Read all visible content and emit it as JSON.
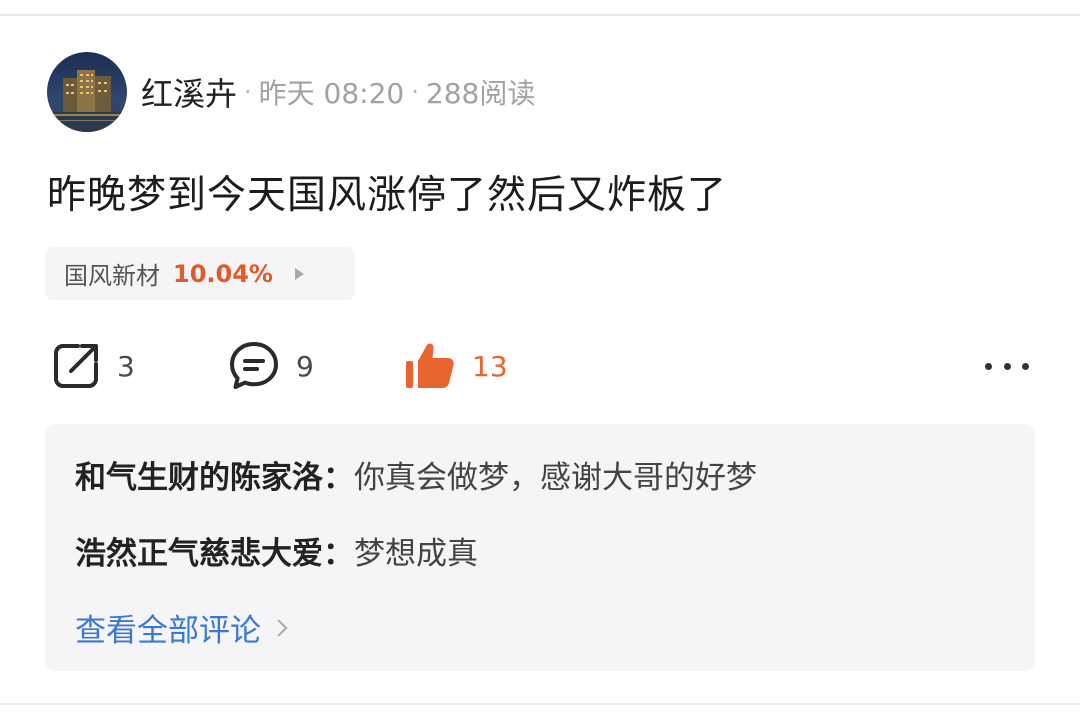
{
  "post": {
    "author": "红溪卉",
    "time": "昨天 08:20",
    "reads": "288阅读",
    "separator": "·",
    "text": "昨晚梦到今天国风涨停了然后又炸板了"
  },
  "stock": {
    "name": "国风新材",
    "change": "10.04%",
    "change_color": "#e05a2b"
  },
  "actions": {
    "share_count": "3",
    "comment_count": "9",
    "like_count": "13",
    "like_color": "#e8652f",
    "icons": [
      "share-icon",
      "comment-icon",
      "thumbs-up-icon",
      "more-icon"
    ]
  },
  "comments": {
    "items": [
      {
        "author": "和气生财的陈家洛",
        "sep": "：",
        "text": "你真会做梦，感谢大哥的好梦"
      },
      {
        "author": "浩然正气慈悲大爱",
        "sep": "：",
        "text": "梦想成真"
      }
    ],
    "view_all": "查看全部评论",
    "link_color": "#3a78d6"
  }
}
